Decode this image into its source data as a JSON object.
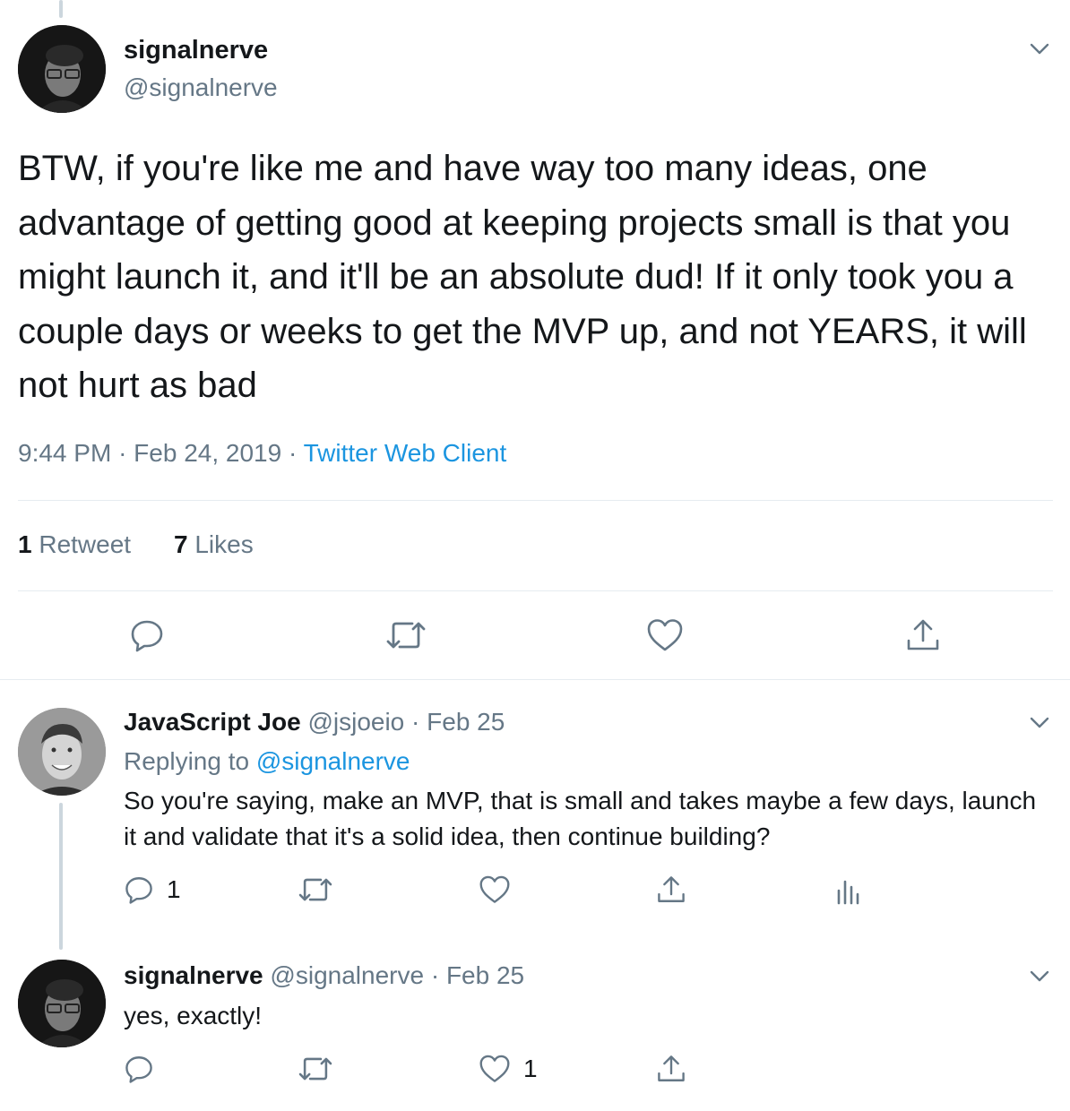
{
  "main_tweet": {
    "display_name": "signalnerve",
    "handle": "@signalnerve",
    "text": "BTW, if you're like me and have way too many ideas, one advantage of getting good at keeping projects small is that you might launch it, and it'll be an absolute dud! If it only took you a couple days or weeks to get the MVP up, and not YEARS, it will not hurt as bad",
    "time": "9:44 PM",
    "separator": "·",
    "date": "Feb 24, 2019",
    "client": "Twitter Web Client",
    "retweet_count": "1",
    "retweet_label": "Retweet",
    "like_count": "7",
    "like_label": "Likes"
  },
  "replies": [
    {
      "display_name": "JavaScript Joe",
      "handle": "@jsjoeio",
      "separator": "·",
      "date": "Feb 25",
      "replying_label": "Replying to",
      "replying_to": "@signalnerve",
      "text": "So you're saying, make an MVP, that is small and takes maybe a few days, launch it and validate that it's a solid idea, then continue building?",
      "reply_count": "1"
    },
    {
      "display_name": "signalnerve",
      "handle": "@signalnerve",
      "separator": "·",
      "date": "Feb 25",
      "text": "yes, exactly!",
      "like_count": "1"
    }
  ],
  "icons": [
    "chevron-down-icon",
    "reply-icon",
    "retweet-icon",
    "like-icon",
    "share-icon",
    "analytics-icon"
  ],
  "colors": {
    "link": "#1b95e0",
    "muted": "#657786",
    "text": "#14171a",
    "divider": "#e6ecf0",
    "thread_line": "#ccd6dd"
  }
}
